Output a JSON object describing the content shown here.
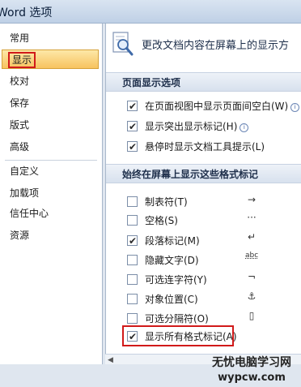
{
  "window": {
    "title": "Word 选项"
  },
  "sidebar": {
    "items": [
      {
        "label": "常用"
      },
      {
        "label": "显示"
      },
      {
        "label": "校对"
      },
      {
        "label": "保存"
      },
      {
        "label": "版式"
      },
      {
        "label": "高级"
      },
      {
        "label": "自定义"
      },
      {
        "label": "加载项"
      },
      {
        "label": "信任中心"
      },
      {
        "label": "资源"
      }
    ],
    "selected": "显示"
  },
  "content": {
    "header": {
      "text": "更改文档内容在屏幕上的显示方",
      "icon": "magnifier-page-icon"
    },
    "page_display": {
      "title": "页面显示选项",
      "options": [
        {
          "label": "在页面视图中显示页面间空白(W)",
          "checked": true,
          "info": true
        },
        {
          "label": "显示突出显示标记(H)",
          "checked": true,
          "info": true
        },
        {
          "label": "悬停时显示文档工具提示(L)",
          "checked": true,
          "info": false
        }
      ]
    },
    "format_marks": {
      "title": "始终在屏幕上显示这些格式标记",
      "options": [
        {
          "label": "制表符(T)",
          "checked": false,
          "symbol": "→"
        },
        {
          "label": "空格(S)",
          "checked": false,
          "symbol": "···"
        },
        {
          "label": "段落标记(M)",
          "checked": true,
          "symbol": "↵"
        },
        {
          "label": "隐藏文字(D)",
          "checked": false,
          "symbol": "abc"
        },
        {
          "label": "可选连字符(Y)",
          "checked": false,
          "symbol": "¬"
        },
        {
          "label": "对象位置(C)",
          "checked": false,
          "symbol": "⚓"
        },
        {
          "label": "可选分隔符(O)",
          "checked": false,
          "symbol": "▯"
        },
        {
          "label": "显示所有格式标记(A)",
          "checked": true,
          "symbol": ""
        }
      ]
    }
  },
  "watermark": {
    "line1": "无忧电脑学习网",
    "line2": "wypcw.com"
  },
  "colors": {
    "selection": "#f7c35f",
    "annotation": "#d11a1a",
    "section_bg": "#d8e1ee"
  }
}
